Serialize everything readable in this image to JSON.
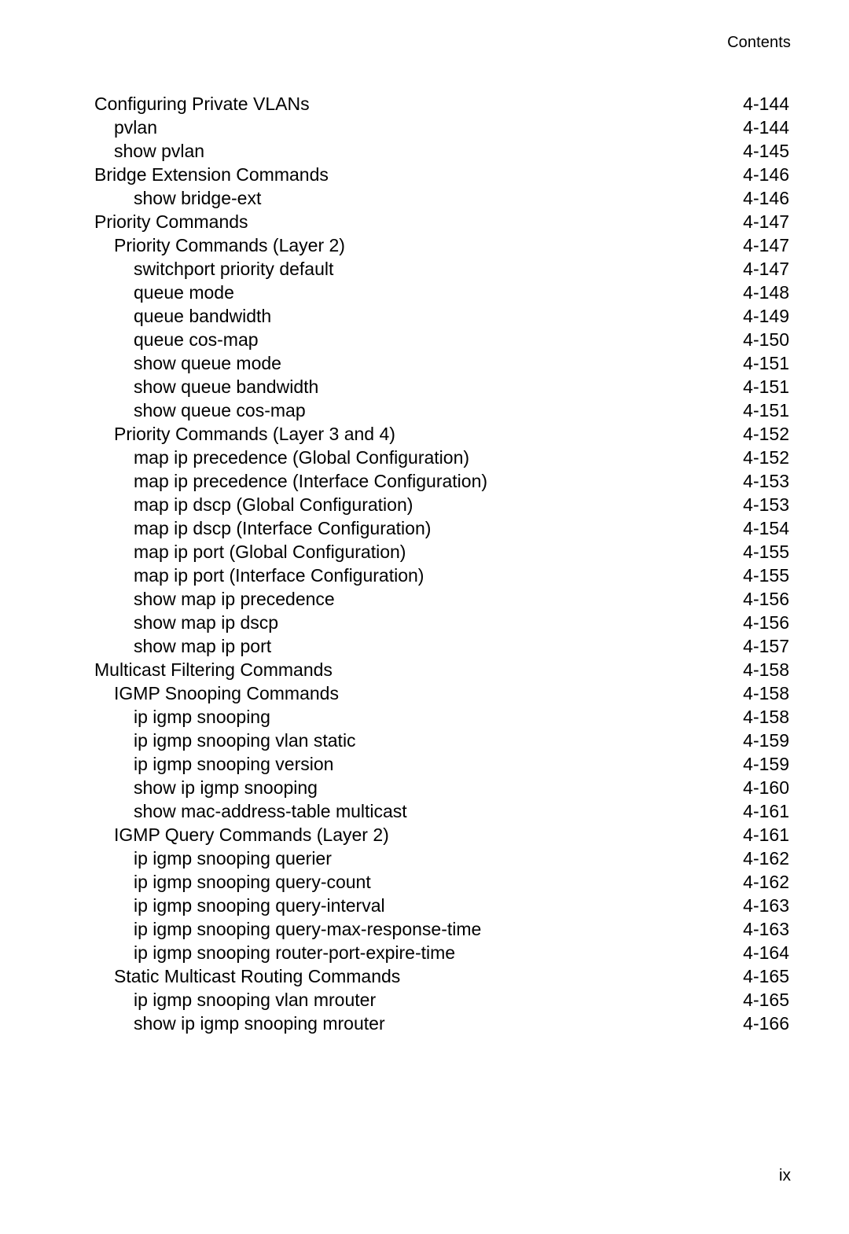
{
  "document": {
    "running_header": "Contents",
    "folio": "ix"
  },
  "toc": {
    "entries": [
      {
        "title": "Configuring Private VLANs",
        "page": "4-144",
        "level": 0
      },
      {
        "title": "pvlan",
        "page": "4-144",
        "level": 1
      },
      {
        "title": "show pvlan",
        "page": "4-145",
        "level": 1
      },
      {
        "title": "Bridge Extension Commands",
        "page": "4-146",
        "level": 0
      },
      {
        "title": "show bridge-ext",
        "page": "4-146",
        "level": 2
      },
      {
        "title": "Priority Commands",
        "page": "4-147",
        "level": 0
      },
      {
        "title": "Priority Commands (Layer 2)",
        "page": "4-147",
        "level": 1
      },
      {
        "title": "switchport priority default",
        "page": "4-147",
        "level": 2
      },
      {
        "title": "queue mode",
        "page": "4-148",
        "level": 2
      },
      {
        "title": "queue bandwidth",
        "page": "4-149",
        "level": 2
      },
      {
        "title": "queue cos-map",
        "page": "4-150",
        "level": 2
      },
      {
        "title": "show queue mode",
        "page": "4-151",
        "level": 2
      },
      {
        "title": "show queue bandwidth",
        "page": "4-151",
        "level": 2
      },
      {
        "title": "show queue cos-map",
        "page": "4-151",
        "level": 2
      },
      {
        "title": "Priority Commands (Layer 3 and 4)",
        "page": "4-152",
        "level": 1
      },
      {
        "title": "map ip precedence (Global Configuration)",
        "page": "4-152",
        "level": 2
      },
      {
        "title": "map ip precedence (Interface Configuration)",
        "page": "4-153",
        "level": 2
      },
      {
        "title": "map ip dscp (Global Configuration)",
        "page": "4-153",
        "level": 2
      },
      {
        "title": "map ip dscp (Interface Configuration)",
        "page": "4-154",
        "level": 2
      },
      {
        "title": "map ip port (Global Configuration)",
        "page": "4-155",
        "level": 2
      },
      {
        "title": "map ip port (Interface Configuration)",
        "page": "4-155",
        "level": 2
      },
      {
        "title": "show map ip precedence",
        "page": "4-156",
        "level": 2
      },
      {
        "title": "show map ip dscp",
        "page": "4-156",
        "level": 2
      },
      {
        "title": "show map ip port",
        "page": "4-157",
        "level": 2
      },
      {
        "title": "Multicast Filtering Commands",
        "page": "4-158",
        "level": 0
      },
      {
        "title": "IGMP Snooping Commands",
        "page": "4-158",
        "level": 1
      },
      {
        "title": "ip igmp snooping",
        "page": "4-158",
        "level": 2
      },
      {
        "title": "ip igmp snooping vlan static",
        "page": "4-159",
        "level": 2
      },
      {
        "title": "ip igmp snooping version",
        "page": "4-159",
        "level": 2
      },
      {
        "title": "show ip igmp snooping",
        "page": "4-160",
        "level": 2
      },
      {
        "title": "show mac-address-table multicast",
        "page": "4-161",
        "level": 2
      },
      {
        "title": "IGMP Query Commands (Layer 2)",
        "page": "4-161",
        "level": 1
      },
      {
        "title": "ip igmp snooping querier",
        "page": "4-162",
        "level": 2
      },
      {
        "title": "ip igmp snooping query-count",
        "page": "4-162",
        "level": 2
      },
      {
        "title": "ip igmp snooping query-interval",
        "page": "4-163",
        "level": 2
      },
      {
        "title": "ip igmp snooping query-max-response-time",
        "page": "4-163",
        "level": 2
      },
      {
        "title": "ip igmp snooping router-port-expire-time",
        "page": "4-164",
        "level": 2
      },
      {
        "title": "Static Multicast Routing Commands",
        "page": "4-165",
        "level": 1
      },
      {
        "title": "ip igmp snooping vlan mrouter",
        "page": "4-165",
        "level": 2
      },
      {
        "title": "show ip igmp snooping mrouter",
        "page": "4-166",
        "level": 2
      }
    ]
  }
}
